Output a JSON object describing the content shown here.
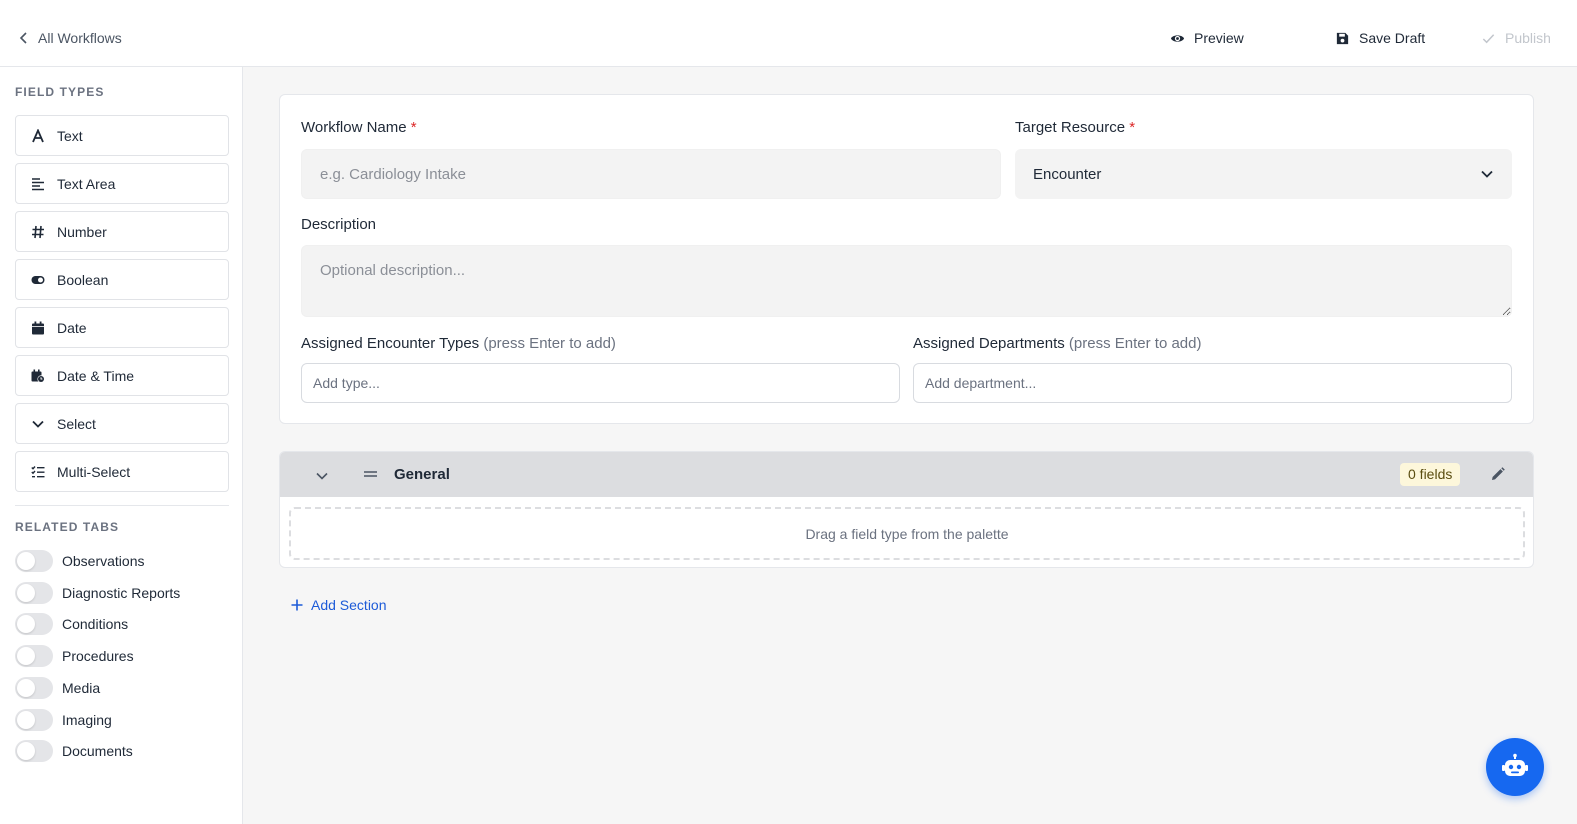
{
  "header": {
    "back_label": "All Workflows",
    "preview_label": "Preview",
    "save_label": "Save Draft",
    "publish_label": "Publish"
  },
  "sidebar": {
    "field_types_heading": "FIELD TYPES",
    "field_types": [
      {
        "label": "Text",
        "icon": "text-icon"
      },
      {
        "label": "Text Area",
        "icon": "text-area-icon"
      },
      {
        "label": "Number",
        "icon": "hash-icon"
      },
      {
        "label": "Boolean",
        "icon": "toggle-icon"
      },
      {
        "label": "Date",
        "icon": "calendar-icon"
      },
      {
        "label": "Date & Time",
        "icon": "calendar-clock-icon"
      },
      {
        "label": "Select",
        "icon": "chevron-down-icon"
      },
      {
        "label": "Multi-Select",
        "icon": "checklist-icon"
      }
    ],
    "related_tabs_heading": "RELATED TABS",
    "related_tabs": [
      {
        "label": "Observations",
        "enabled": false
      },
      {
        "label": "Diagnostic Reports",
        "enabled": false
      },
      {
        "label": "Conditions",
        "enabled": false
      },
      {
        "label": "Procedures",
        "enabled": false
      },
      {
        "label": "Media",
        "enabled": false
      },
      {
        "label": "Imaging",
        "enabled": false
      },
      {
        "label": "Documents",
        "enabled": false
      }
    ]
  },
  "form": {
    "workflow_name_label": "Workflow Name",
    "required_mark": "*",
    "workflow_name_placeholder": "e.g. Cardiology Intake",
    "target_resource_label": "Target Resource",
    "target_resource_value": "Encounter",
    "description_label": "Description",
    "description_placeholder": "Optional description...",
    "encounter_types_label": "Assigned Encounter Types",
    "encounter_types_hint": "(press Enter to add)",
    "encounter_types_placeholder": "Add type...",
    "departments_label": "Assigned Departments",
    "departments_hint": "(press Enter to add)",
    "departments_placeholder": "Add department..."
  },
  "section": {
    "title": "General",
    "field_count_label": "0 fields",
    "dropzone_text": "Drag a field type from the palette"
  },
  "add_section_label": "Add Section",
  "colors": {
    "accent": "#1668f0",
    "required": "#dc2626",
    "badge_bg": "#fdf7db"
  }
}
